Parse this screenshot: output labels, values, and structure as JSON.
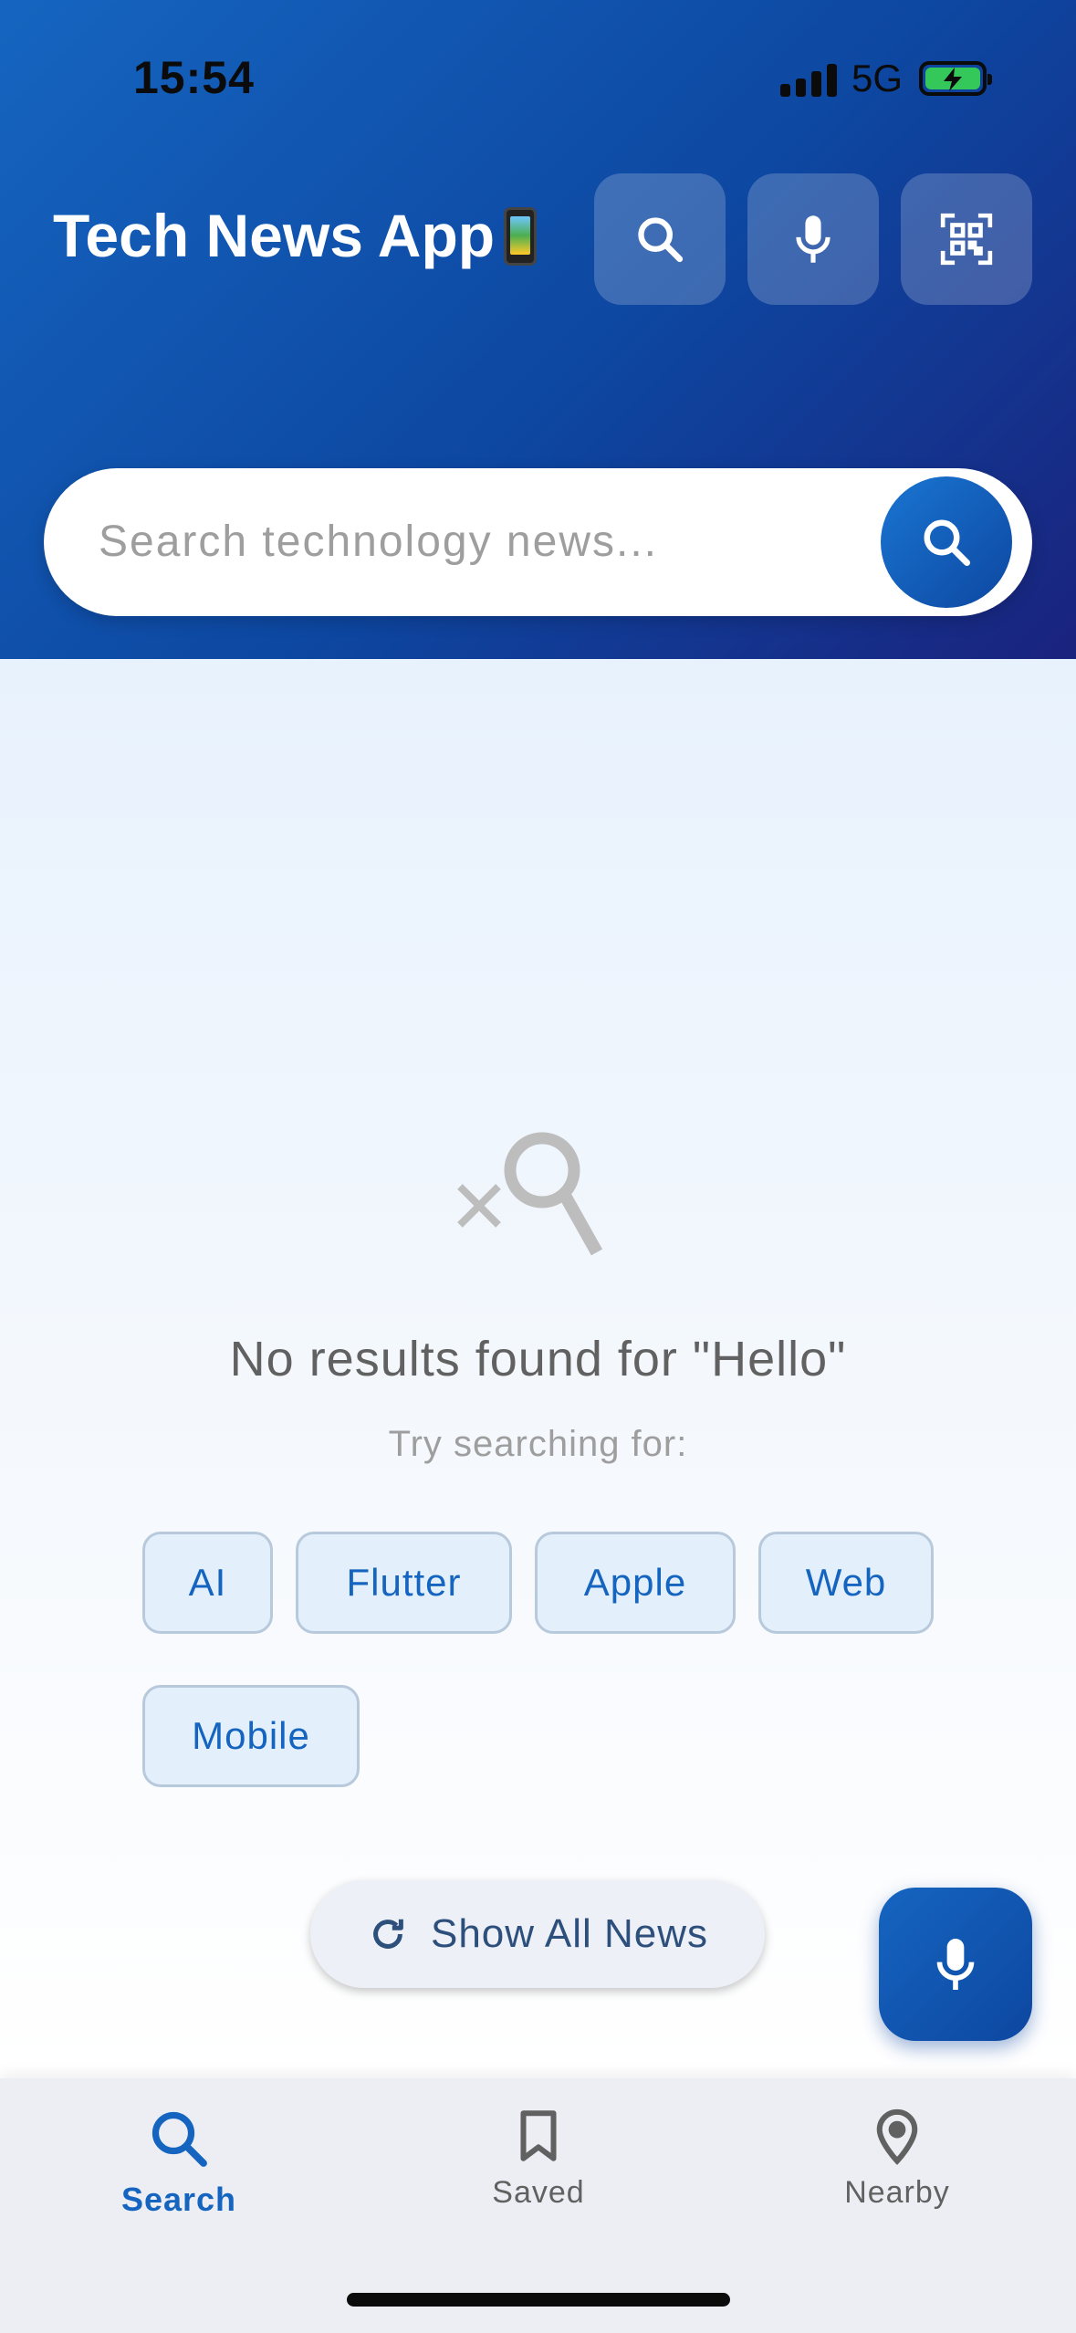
{
  "status_bar": {
    "time": "15:54",
    "network": "5G"
  },
  "header": {
    "title": "Tech News App",
    "buttons": [
      "search-icon",
      "mic-icon",
      "qr-scan-icon"
    ]
  },
  "search": {
    "placeholder": "Search technology news...",
    "value": ""
  },
  "empty_state": {
    "icon": "search-off-icon",
    "title": "No results found for \"Hello\"",
    "subtitle": "Try searching for:",
    "suggestions": [
      "AI",
      "Flutter",
      "Apple",
      "Web",
      "Mobile"
    ]
  },
  "show_all_label": "Show All News",
  "bottom_nav": {
    "items": [
      {
        "label": "Search",
        "icon": "search-icon",
        "active": true
      },
      {
        "label": "Saved",
        "icon": "bookmark-icon",
        "active": false
      },
      {
        "label": "Nearby",
        "icon": "location-pin-icon",
        "active": false
      }
    ]
  },
  "colors": {
    "primary": "#1565c0",
    "primary_dark": "#0d47a1",
    "header_end": "#1a237e",
    "chip_bg": "#e3f0fc"
  }
}
